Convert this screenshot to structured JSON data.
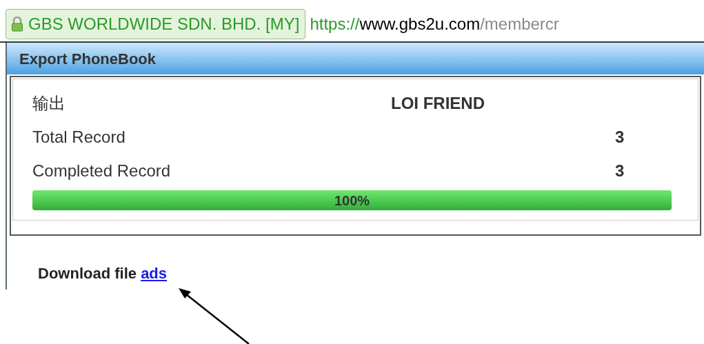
{
  "address_bar": {
    "certificate": "GBS WORLDWIDE SDN. BHD. [MY]",
    "url_scheme": "https://",
    "url_host": "www.gbs2u.com",
    "url_path": "/membercr"
  },
  "panel": {
    "title": "Export PhoneBook",
    "rows": [
      {
        "kind": "heading",
        "label": "输出",
        "value": "LOI FRIEND"
      },
      {
        "kind": "count",
        "label": "Total Record",
        "value": "3"
      },
      {
        "kind": "count",
        "label": "Completed Record",
        "value": "3"
      }
    ],
    "progress": {
      "level": 1,
      "label": "100%"
    }
  },
  "download": {
    "text": "Download file",
    "link": "ads"
  }
}
